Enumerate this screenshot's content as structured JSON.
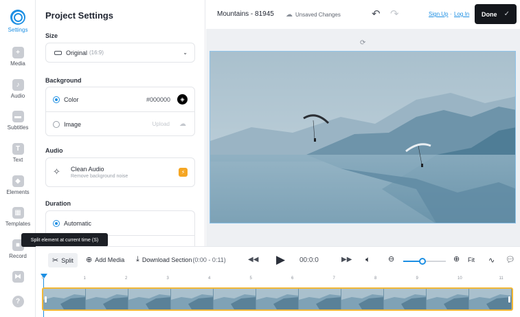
{
  "rail": {
    "items": [
      {
        "label": "Settings",
        "icon": "gear-icon"
      },
      {
        "label": "Media",
        "icon": "plus-icon"
      },
      {
        "label": "Audio",
        "icon": "music-note-icon"
      },
      {
        "label": "Subtitles",
        "icon": "subtitles-icon"
      },
      {
        "label": "Text",
        "icon": "text-icon"
      },
      {
        "label": "Elements",
        "icon": "shapes-icon"
      },
      {
        "label": "Templates",
        "icon": "templates-icon"
      },
      {
        "label": "Record",
        "icon": "record-icon"
      }
    ],
    "extra_icons": [
      "transitions-icon",
      "help-icon"
    ]
  },
  "panel": {
    "title": "Project Settings",
    "size": {
      "label": "Size",
      "value": "Original",
      "ratio": "(16:9)"
    },
    "background": {
      "label": "Background",
      "color_option": "Color",
      "color_value": "#000000",
      "image_option": "Image",
      "upload": "Upload"
    },
    "audio": {
      "label": "Audio",
      "title": "Clean Audio",
      "subtitle": "Remove background noise"
    },
    "duration": {
      "label": "Duration",
      "option": "Automatic"
    }
  },
  "topbar": {
    "project_name": "Mountains - 81945",
    "status": "Unsaved Changes",
    "sign_up": "Sign Up",
    "separator": "·",
    "log_in": "Log In",
    "done": "Done"
  },
  "toolbar": {
    "split": "Split",
    "add_media": "Add Media",
    "download": "Download Section",
    "download_range": "(0:00 - 0:11)",
    "time": "00:0:0",
    "zoom_label": "Fit",
    "zoom_level": 0.45
  },
  "tooltip": "Split element at current time (S)",
  "timeline": {
    "ticks": [
      "0",
      "1",
      "2",
      "3",
      "4",
      "5",
      "6",
      "7",
      "8",
      "9",
      "10",
      "11"
    ],
    "clip_frames": 11
  },
  "colors": {
    "accent": "#1d8fe3",
    "clip_border": "#f2b736",
    "done_bg": "#14171c",
    "badge": "#f5a623"
  }
}
